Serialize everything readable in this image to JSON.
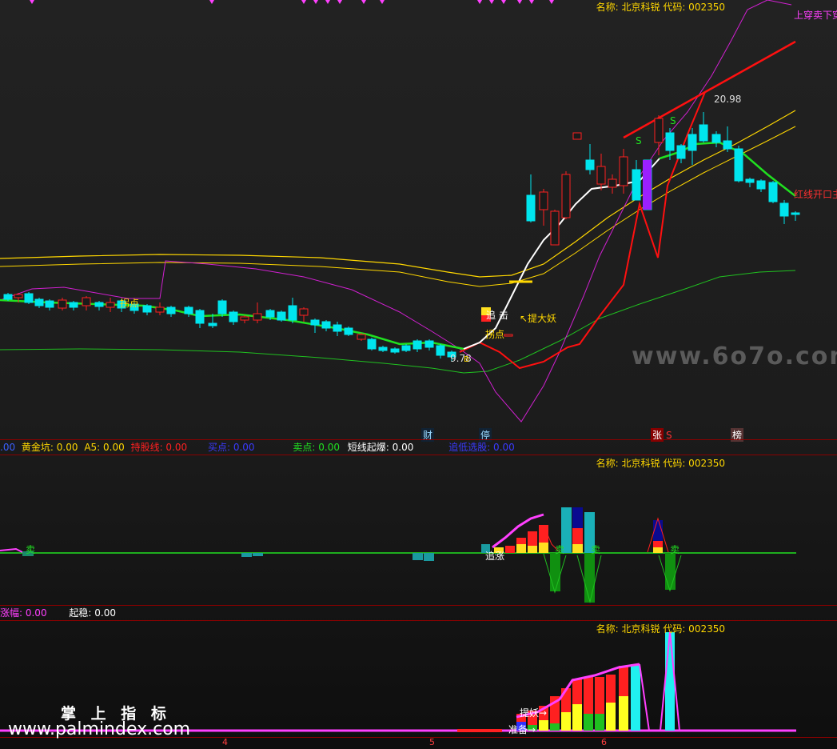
{
  "stock": {
    "name_label": "名称: 北京科锐 代码: 002350"
  },
  "main_panel": {
    "price_high_label": "20.98",
    "price_low_label": "9.78",
    "annotations": {
      "top_right": "上穿卖下穿",
      "red_line_open": "红线开口主",
      "hold_point_left": "拐点",
      "lift_monster": "↖提大妖",
      "zhui_ji": "追 击",
      "turn_point": "拐点",
      "s1": "S",
      "s2": "S",
      "s3": "S",
      "b_mark": "B"
    },
    "bottom_signals": [
      "财",
      "停",
      "张",
      "S",
      "榜"
    ]
  },
  "indicator_bar_1": {
    "items": [
      {
        "label": ".00",
        "color": "#3a5fff"
      },
      {
        "label": "黄金坑: 0.00",
        "color": "#ffd700"
      },
      {
        "label": "A5: 0.00",
        "color": "#ffd700"
      },
      {
        "label": "持股线: 0.00",
        "color": "#ff2020"
      },
      {
        "label": "买点: 0.00",
        "color": "#3a3aff"
      },
      {
        "label": "卖点: 0.00",
        "color": "#20e020"
      },
      {
        "label": "短线起爆: 0.00",
        "color": "#ffffff"
      },
      {
        "label": "追低选股: 0.00",
        "color": "#3a3aff"
      }
    ]
  },
  "middle_panel": {
    "labels": {
      "sell_left": "卖",
      "zhui_zhang": "追涨",
      "sell_a": "卖",
      "sell_b": "卖",
      "sell_c": "卖"
    }
  },
  "indicator_bar_2": {
    "items": [
      {
        "label": "涨幅: 0.00",
        "color": "#ff40ff"
      },
      {
        "label": "起稳: 0.00",
        "color": "#ffffff"
      }
    ]
  },
  "bottom_panel": {
    "labels": {
      "lift_monster": "提妖→",
      "prepare": "准备→"
    },
    "x_axis_labels": [
      "4",
      "5",
      "6"
    ]
  },
  "watermarks": {
    "site_right": "www.6o7o.com",
    "cn_brand": "掌 上 指 标",
    "site_left": "www.palmindex.com"
  },
  "colors": {
    "up_candle": "#ff2020",
    "down_candle": "#00e5ee",
    "upper_band": "#ffd700",
    "purple_line": "#d020d0",
    "green_band": "#20c020",
    "hold_line": "#ff1010",
    "sep_line": "#8b0000"
  },
  "chart_data": {
    "type": "candlestick",
    "price_high": 20.98,
    "price_low": 9.78,
    "x_axis_labels": [
      "4",
      "5",
      "6"
    ]
  }
}
